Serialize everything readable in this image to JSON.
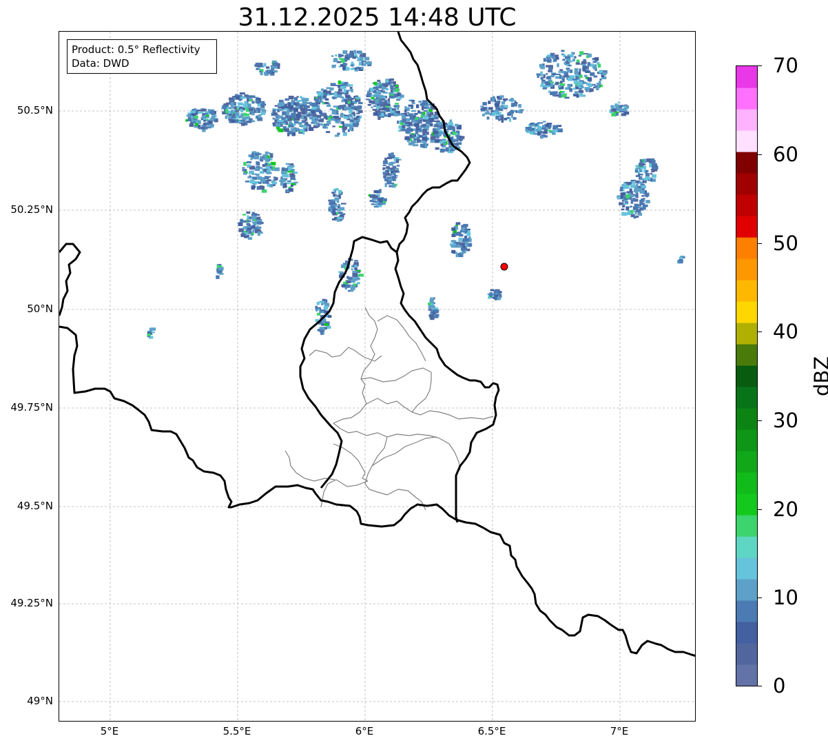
{
  "title": "31.12.2025 14:48 UTC",
  "info_box": {
    "product": "Product: 0.5° Reflectivity",
    "data": "Data: DWD"
  },
  "map": {
    "lat_ticks": [
      "50.5°N",
      "50.25°N",
      "50°N",
      "49.75°N",
      "49.5°N",
      "49.25°N",
      "49°N"
    ],
    "lon_ticks": [
      "5°E",
      "5.5°E",
      "6°E",
      "6.5°E",
      "7°E"
    ],
    "extent": {
      "lon_min": 4.8,
      "lon_max": 7.3,
      "lat_min": 48.95,
      "lat_max": 50.7
    },
    "radar_site": {
      "lon": 6.547,
      "lat": 50.112,
      "color": "#ff0000"
    },
    "border_color": "#000000",
    "district_color": "#808080",
    "grid_color": "#b0b0b0"
  },
  "colorbar": {
    "label": "dBZ",
    "tick_labels": [
      "70",
      "60",
      "50",
      "40",
      "30",
      "20",
      "10",
      "0"
    ],
    "min": 0,
    "max": 70,
    "colors": [
      "#6373a8",
      "#52669e",
      "#4360a0",
      "#4c7ab3",
      "#5da0c8",
      "#65c3dc",
      "#5fd6c4",
      "#3cd46c",
      "#12c91c",
      "#10bb1a",
      "#10a818",
      "#0e9616",
      "#0c8414",
      "#08741a",
      "#085c10",
      "#4a7a0a",
      "#b0b000",
      "#ffd700",
      "#ffb800",
      "#ff9800",
      "#ff7f00",
      "#e00000",
      "#c00000",
      "#a00000",
      "#800000",
      "#ffe0ff",
      "#ffb3ff",
      "#ff70ff",
      "#e838e8"
    ]
  }
}
